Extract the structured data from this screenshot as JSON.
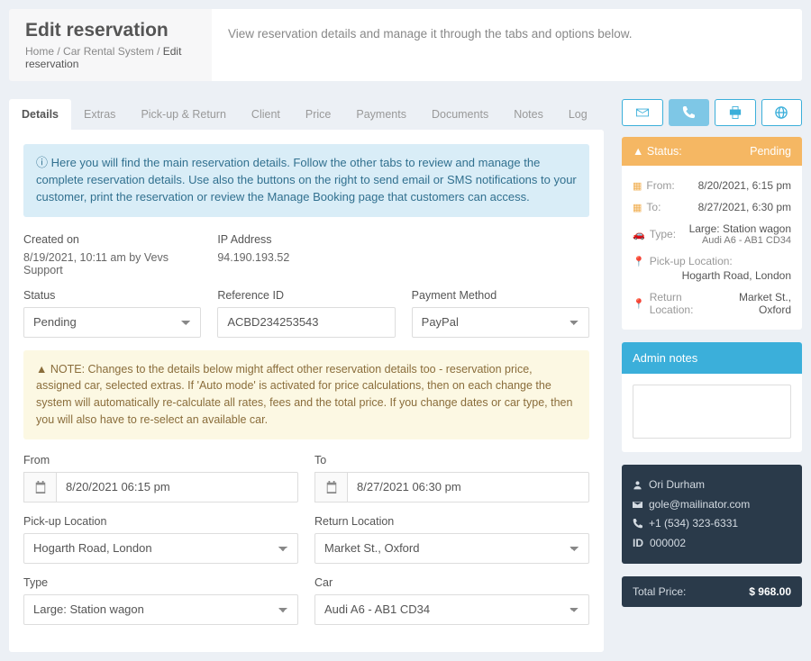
{
  "header": {
    "title": "Edit reservation",
    "breadcrumb": [
      "Home",
      "Car Rental System",
      "Edit reservation"
    ],
    "subtitle": "View reservation details and manage it through the tabs and options below."
  },
  "tabs": [
    "Details",
    "Extras",
    "Pick-up & Return",
    "Client",
    "Price",
    "Payments",
    "Documents",
    "Notes",
    "Log"
  ],
  "active_tab": 0,
  "info_alert": "Here you will find the main reservation details. Follow the other tabs to review and manage the complete reservation details. Use also the buttons on the right to send email or SMS notifications to your customer, print the reservation or review the Manage Booking page that customers can access.",
  "meta": {
    "created_label": "Created on",
    "created_value": "8/19/2021, 10:11 am by Vevs Support",
    "ip_label": "IP Address",
    "ip_value": "94.190.193.52"
  },
  "fields": {
    "status": {
      "label": "Status",
      "value": "Pending"
    },
    "reference": {
      "label": "Reference ID",
      "value": "ACBD234253543"
    },
    "payment_method": {
      "label": "Payment Method",
      "value": "PayPal"
    }
  },
  "warn_alert": "NOTE: Changes to the details below might affect other reservation details too - reservation price, assigned car, selected extras. If 'Auto mode' is activated for price calculations, then on each change the system will automatically re-calculate all rates, fees and the total price. If you change dates or car type, then you will also have to re-select an available car.",
  "dates": {
    "from": {
      "label": "From",
      "value": "8/20/2021 06:15 pm"
    },
    "to": {
      "label": "To",
      "value": "8/27/2021 06:30 pm"
    }
  },
  "locations": {
    "pickup": {
      "label": "Pick-up Location",
      "value": "Hogarth Road, London"
    },
    "return": {
      "label": "Return Location",
      "value": "Market St., Oxford"
    }
  },
  "car": {
    "type": {
      "label": "Type",
      "value": "Large: Station wagon"
    },
    "model": {
      "label": "Car",
      "value": "Audi A6 - AB1 CD34"
    }
  },
  "summary": {
    "status_label": "Status:",
    "status_value": "Pending",
    "from_label": "From:",
    "from_value": "8/20/2021, 6:15 pm",
    "to_label": "To:",
    "to_value": "8/27/2021, 6:30 pm",
    "type_label": "Type:",
    "type_value": "Large: Station wagon",
    "car_value": "Audi A6 - AB1 CD34",
    "pickup_label": "Pick-up Location:",
    "pickup_value": "Hogarth Road, London",
    "return_label": "Return Location:",
    "return_value": "Market St., Oxford"
  },
  "notes": {
    "heading": "Admin notes"
  },
  "customer": {
    "name": "Ori Durham",
    "email": "gole@mailinator.com",
    "phone": "+1 (534) 323-6331",
    "id_label": "ID",
    "id_value": "000002"
  },
  "price": {
    "label": "Total Price:",
    "value": "$ 968.00"
  }
}
